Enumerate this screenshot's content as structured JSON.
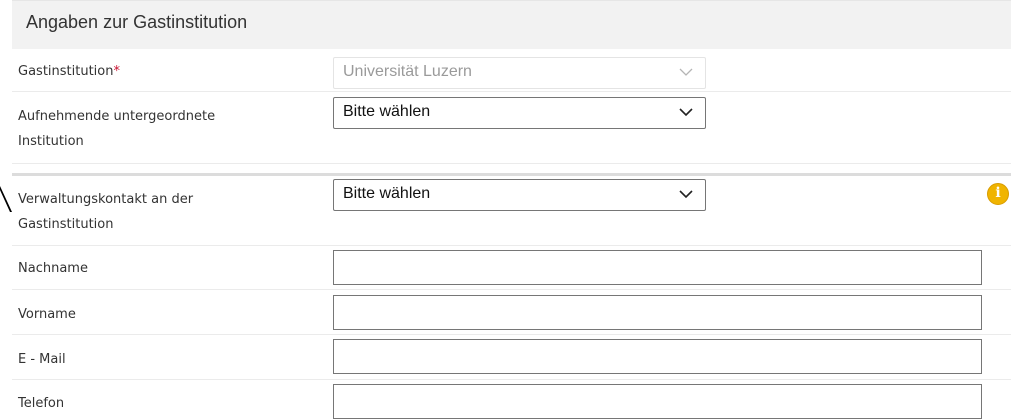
{
  "section": {
    "title": "Angaben zur Gastinstitution"
  },
  "fields": {
    "gastinstitution": {
      "label": "Gastinstitution",
      "required_marker": "*",
      "value": "Universität Luzern"
    },
    "aufnehmende": {
      "label_line1": "Aufnehmende untergeordnete",
      "label_line2": "Institution",
      "value": "Bitte wählen"
    },
    "verwaltungskontakt": {
      "label_line1": "Verwaltungskontakt an der",
      "label_line2": "Gastinstitution",
      "value": "Bitte wählen"
    },
    "nachname": {
      "label": "Nachname",
      "value": ""
    },
    "vorname": {
      "label": "Vorname",
      "value": ""
    },
    "email": {
      "label": "E - Mail",
      "value": ""
    },
    "telefon": {
      "label": "Telefon",
      "value": ""
    }
  },
  "icons": {
    "info": "info-icon",
    "dropdown": "chevron-down-icon"
  },
  "colors": {
    "required": "#c8102e",
    "info": "#f0b400",
    "header_bg": "#f2f2f2"
  }
}
